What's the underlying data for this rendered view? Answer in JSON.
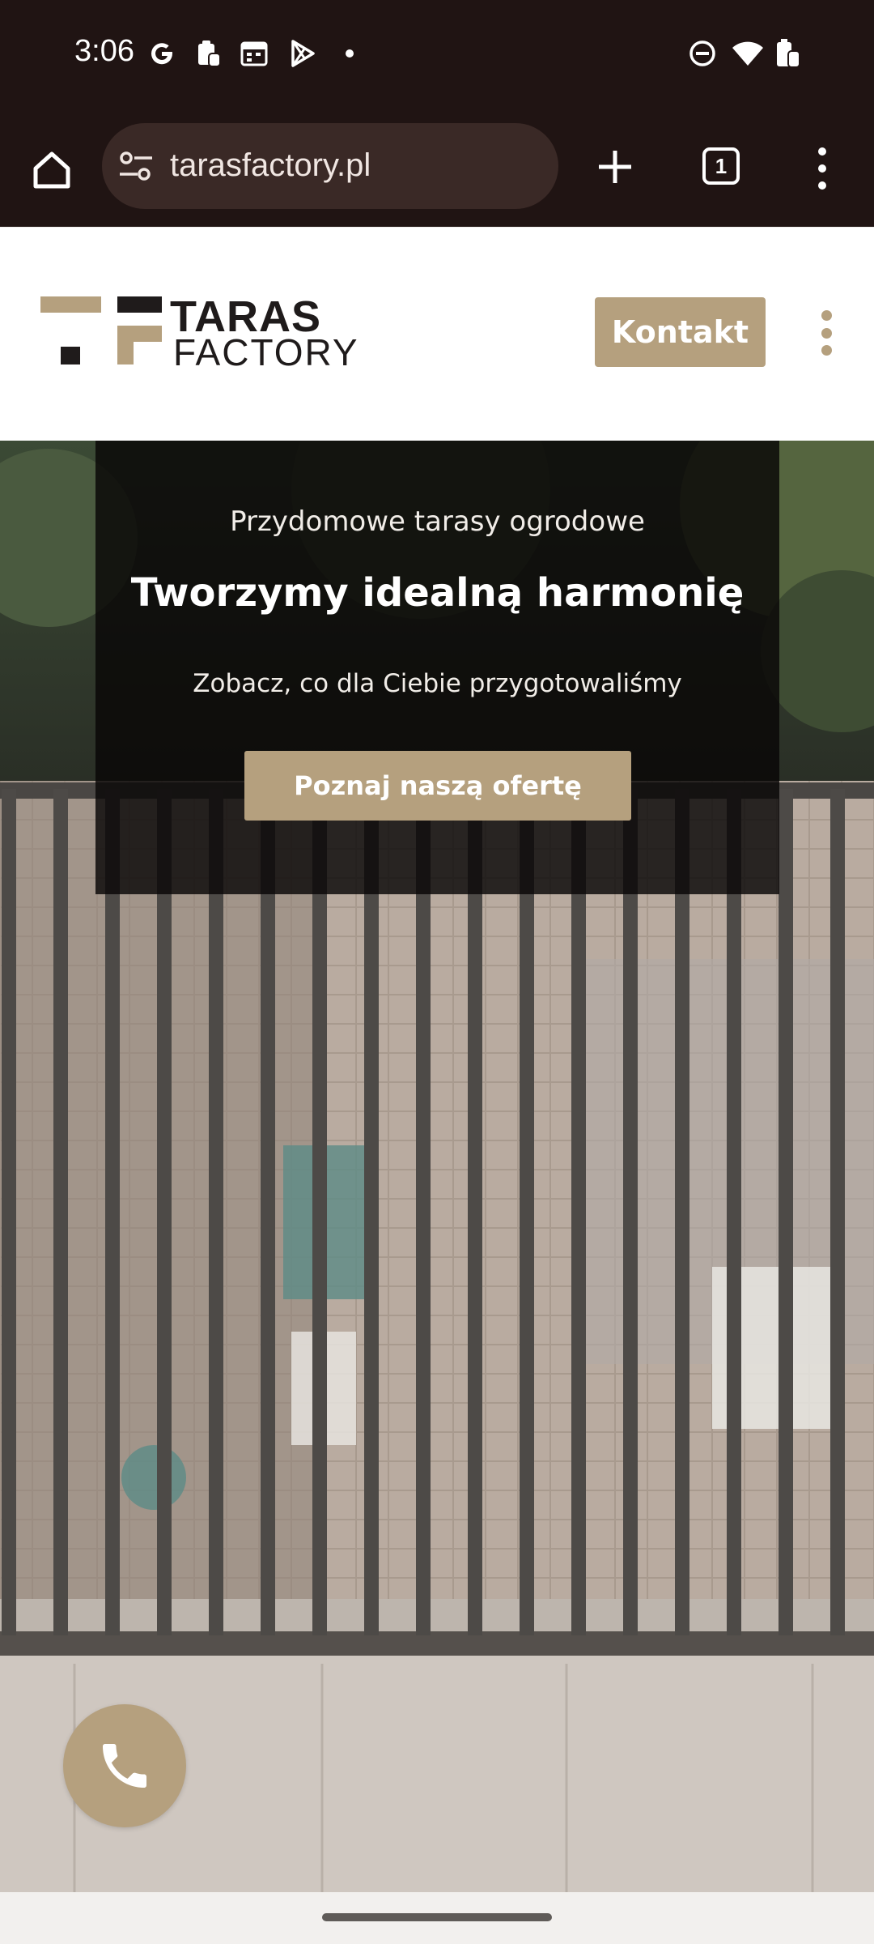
{
  "status_bar": {
    "time": "3:06",
    "left_icons": [
      "google-icon",
      "clipboard-icon",
      "calendar-icon",
      "play-store-icon",
      "dot-icon"
    ],
    "right_icons": [
      "dnd-icon",
      "wifi-icon",
      "battery-icon"
    ]
  },
  "browser": {
    "url": "tarasfactory.pl",
    "tab_count": "1"
  },
  "site": {
    "logo_line1": "TARAS",
    "logo_line2": "FACTORY",
    "contact_button": "Kontakt",
    "brand_color": "#b5a07e"
  },
  "hero": {
    "kicker": "Przydomowe tarasy ogrodowe",
    "title": "Tworzymy idealną harmonię",
    "subtitle": "Zobacz, co dla Ciebie przygotowaliśmy",
    "cta": "Poznaj naszą ofertę"
  }
}
